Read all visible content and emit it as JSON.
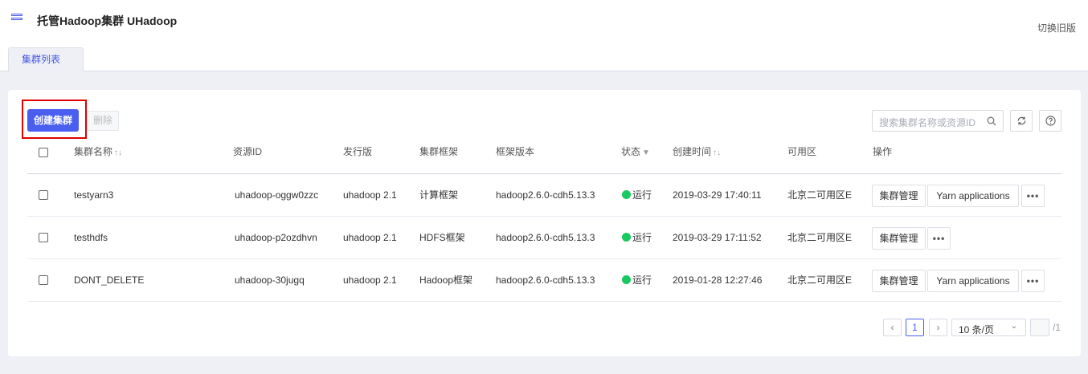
{
  "header": {
    "title": "托管Hadoop集群 UHadoop",
    "switch_label": "切换旧版"
  },
  "tabs": [
    {
      "label": "集群列表"
    }
  ],
  "toolbar": {
    "create_label": "创建集群",
    "delete_label": "删除",
    "search_placeholder": "搜索集群名称或资源ID"
  },
  "table": {
    "columns": [
      "集群名称",
      "资源ID",
      "发行版",
      "集群框架",
      "框架版本",
      "状态",
      "创建时间",
      "可用区",
      "操作"
    ],
    "rows": [
      {
        "name": "testyarn3",
        "id": "uhadoop-oggw0zzc",
        "dist": "uhadoop 2.1",
        "framework": "计算框架",
        "version": "hadoop2.6.0-cdh5.13.3",
        "status": "运行",
        "created": "2019-03-29 17:40:11",
        "zone": "北京二可用区E",
        "actions": [
          "集群管理",
          "Yarn applications",
          "•••"
        ]
      },
      {
        "name": "testhdfs",
        "id": "uhadoop-p2ozdhvn",
        "dist": "uhadoop 2.1",
        "framework": "HDFS框架",
        "version": "hadoop2.6.0-cdh5.13.3",
        "status": "运行",
        "created": "2019-03-29 17:11:52",
        "zone": "北京二可用区E",
        "actions": [
          "集群管理",
          "•••"
        ]
      },
      {
        "name": "DONT_DELETE",
        "id": "uhadoop-30jugq",
        "dist": "uhadoop 2.1",
        "framework": "Hadoop框架",
        "version": "hadoop2.6.0-cdh5.13.3",
        "status": "运行",
        "created": "2019-01-28 12:27:46",
        "zone": "北京二可用区E",
        "actions": [
          "集群管理",
          "Yarn applications",
          "•••"
        ]
      }
    ]
  },
  "pagination": {
    "current": "1",
    "page_size": "10 条/页",
    "total": "/1",
    "prev": "‹",
    "next": "›"
  },
  "colors": {
    "accent": "#4a5ef0",
    "status_running": "#17c95f",
    "highlight": "#e00000"
  },
  "icons": [
    "menu-icon",
    "search-icon",
    "refresh-icon",
    "help-icon",
    "sort-icon",
    "filter-icon",
    "chevron-down-icon"
  ]
}
